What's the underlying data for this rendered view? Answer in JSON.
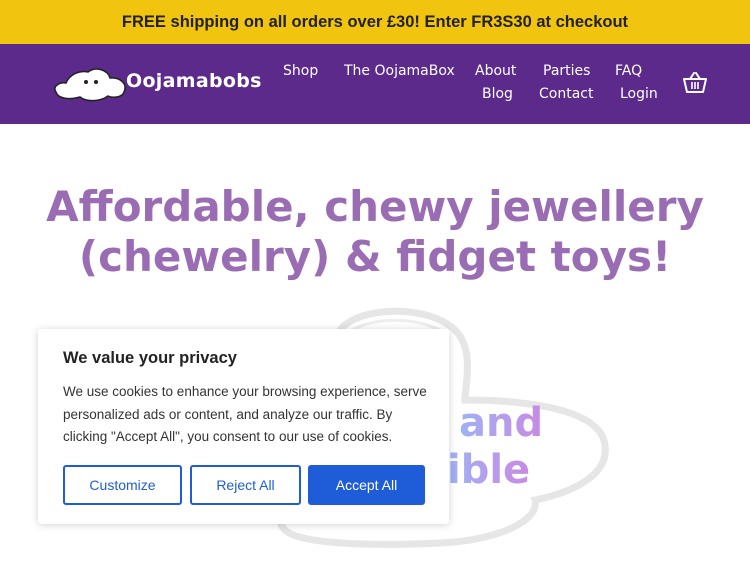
{
  "banner": {
    "text": "FREE shipping on all orders over £30! Enter FR3S30 at checkout"
  },
  "header": {
    "brand": "Oojamabobs",
    "nav": [
      {
        "label": "Shop"
      },
      {
        "label": "The OojamaBox"
      },
      {
        "label": "About"
      },
      {
        "label": "Parties"
      },
      {
        "label": "FAQ"
      },
      {
        "label": "Blog"
      },
      {
        "label": "Contact"
      },
      {
        "label": "Login"
      }
    ],
    "cart_icon": "basket-icon"
  },
  "hero": {
    "title_line1": "Affordable, chewy jewellery",
    "title_line2": "(chewelry) & fidget toys!",
    "partial_line1": "and",
    "partial_line2": "ible"
  },
  "cookie_banner": {
    "title": "We value your privacy",
    "text": "We use cookies to enhance your browsing experience, serve personalized ads or content, and analyze our traffic. By clicking \"Accept All\", you consent to our use of cookies.",
    "buttons": {
      "customize": "Customize",
      "reject": "Reject All",
      "accept": "Accept All"
    }
  },
  "colors": {
    "banner_bg": "#f1c40f",
    "nav_bg": "#5b2a8a",
    "title_purple": "#9a6cb3",
    "button_blue": "#1e5cd8"
  }
}
